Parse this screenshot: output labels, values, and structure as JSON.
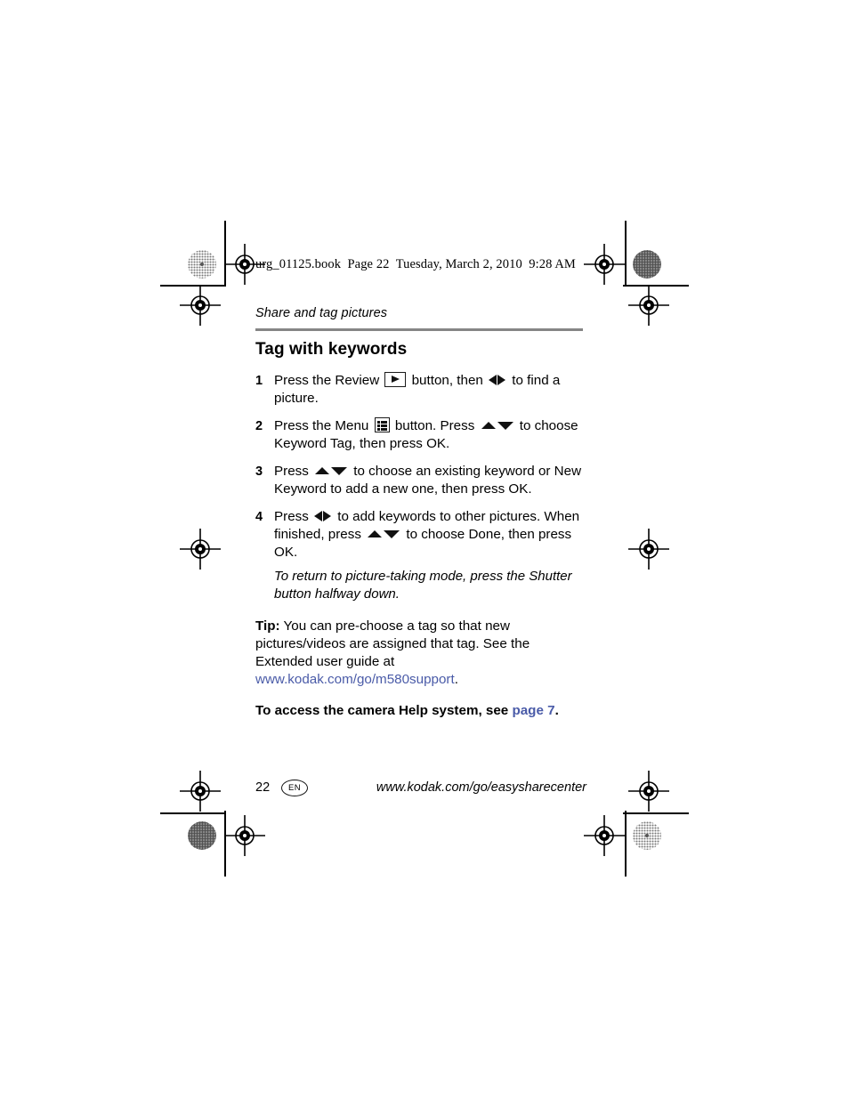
{
  "file_line": "urg_01125.book  Page 22  Tuesday, March 2, 2010  9:28 AM",
  "running_head": "Share and tag pictures",
  "section_title": "Tag with keywords",
  "steps": [
    {
      "number": "1",
      "parts": [
        {
          "type": "text",
          "value": "Press the Review "
        },
        {
          "type": "icon",
          "value": "review-button-icon"
        },
        {
          "type": "text",
          "value": " button, then "
        },
        {
          "type": "icon",
          "value": "left-arrow-icon"
        },
        {
          "type": "icon",
          "value": "right-arrow-icon"
        },
        {
          "type": "text",
          "value": " to find a picture."
        }
      ],
      "text_a": "Press the Review ",
      "text_b": " button, then ",
      "text_c": " to find a picture."
    },
    {
      "number": "2",
      "text_a": "Press the Menu ",
      "text_b": " button. Press ",
      "text_c": " to choose Keyword Tag, then press OK."
    },
    {
      "number": "3",
      "text_a": "Press ",
      "text_c": " to choose an existing keyword or New Keyword to add a new one, then press OK."
    },
    {
      "number": "4",
      "text_a": "Press ",
      "text_b": " to add keywords to other pictures. When finished, press ",
      "text_c": " to choose Done, then press OK.",
      "note": "To return to picture-taking mode, press the Shutter button halfway down."
    }
  ],
  "tip": {
    "lead": "Tip:",
    "body": " You can pre-choose a tag so that new pictures/videos are assigned that tag. See the Extended user guide at ",
    "link": "www.kodak.com/go/m580support",
    "period": "."
  },
  "help_line": {
    "text": "To access the camera Help system, see ",
    "link": "page 7",
    "period": "."
  },
  "footer": {
    "page_number": "22",
    "language_badge": "EN",
    "url": "www.kodak.com/go/easysharecenter"
  },
  "colors": {
    "link": "#4a5ba8",
    "rule": "#868686",
    "text": "#000000"
  }
}
